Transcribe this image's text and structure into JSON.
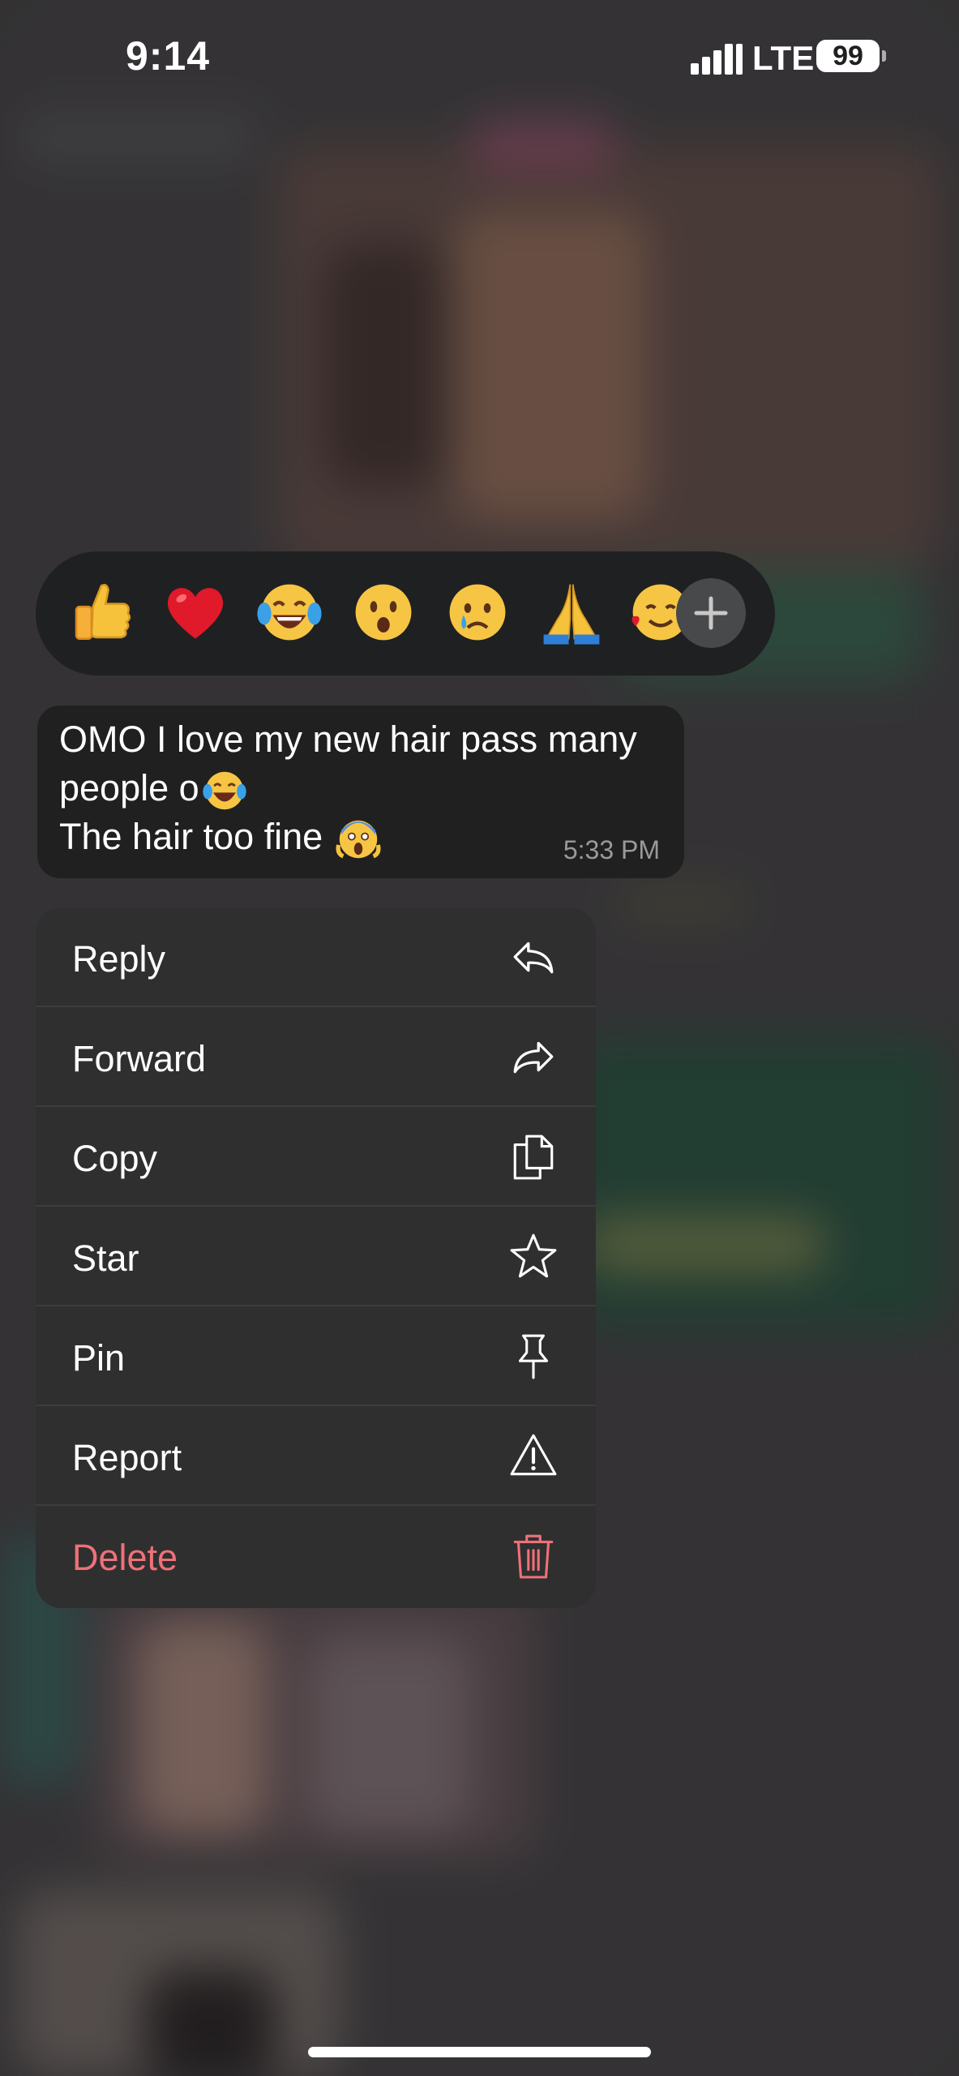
{
  "status_bar": {
    "time": "9:14",
    "network": "LTE",
    "battery": "99"
  },
  "reactions": {
    "emojis": [
      "thumbs-up",
      "red-heart",
      "tears-of-joy",
      "surprised",
      "crying",
      "folded-hands",
      "smiling-with-hearts"
    ],
    "add_icon": "plus-icon"
  },
  "message": {
    "line1": "OMO I love my new hair pass many",
    "line2": "people o",
    "line2_emoji": "tears-of-joy",
    "line3": "The hair too fine",
    "line3_emoji": "screaming-in-fear",
    "time": "5:33 PM"
  },
  "menu": {
    "items": [
      {
        "label": "Reply",
        "icon": "reply-icon"
      },
      {
        "label": "Forward",
        "icon": "forward-icon"
      },
      {
        "label": "Copy",
        "icon": "copy-icon"
      },
      {
        "label": "Star",
        "icon": "star-icon"
      },
      {
        "label": "Pin",
        "icon": "pin-icon"
      },
      {
        "label": "Report",
        "icon": "warning-icon"
      },
      {
        "label": "Delete",
        "icon": "trash-icon"
      }
    ]
  },
  "colors": {
    "delete": "#ee7179",
    "menu_bg": "#2f2f2f",
    "bubble_bg": "#202020"
  }
}
